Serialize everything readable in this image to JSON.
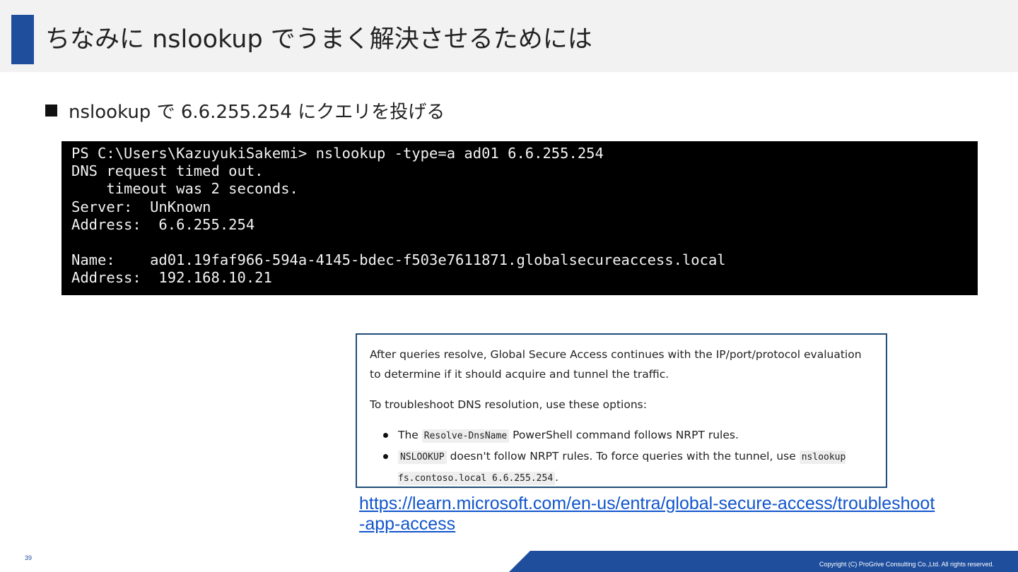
{
  "slide": {
    "title": "ちなみに nslookup でうまく解決させるためには",
    "bullet": "nslookup で 6.6.255.254 にクエリを投げる",
    "page_number": "39",
    "copyright": "Copyright (C) ProGrive Consulting Co.,Ltd. All rights reserved.",
    "accent_color": "#1f4e9d"
  },
  "terminal": {
    "lines": [
      "PS C:\\Users\\KazuyukiSakemi> nslookup -type=a ad01 6.6.255.254",
      "DNS request timed out.",
      "    timeout was 2 seconds.",
      "Server:  UnKnown",
      "Address:  6.6.255.254",
      "",
      "Name:    ad01.19faf966-594a-4145-bdec-f503e7611871.globalsecureaccess.local",
      "Address:  192.168.10.21"
    ]
  },
  "doc": {
    "para1": "After queries resolve, Global Secure Access continues with the IP/port/protocol evaluation to determine if it should acquire and tunnel the traffic.",
    "para2": "To troubleshoot DNS resolution, use these options:",
    "item1": {
      "pre": "The",
      "code": "Resolve-DnsName",
      "post": "PowerShell command follows NRPT rules."
    },
    "item2": {
      "code1": "NSLOOKUP",
      "mid": "doesn't follow NRPT rules. To force queries with the tunnel, use",
      "code2": "nslookup fs.contoso.local 6.6.255.254",
      "end": "."
    }
  },
  "link": {
    "text": "https://learn.microsoft.com/en-us/entra/global-secure-access/troubleshoot-app-access"
  }
}
